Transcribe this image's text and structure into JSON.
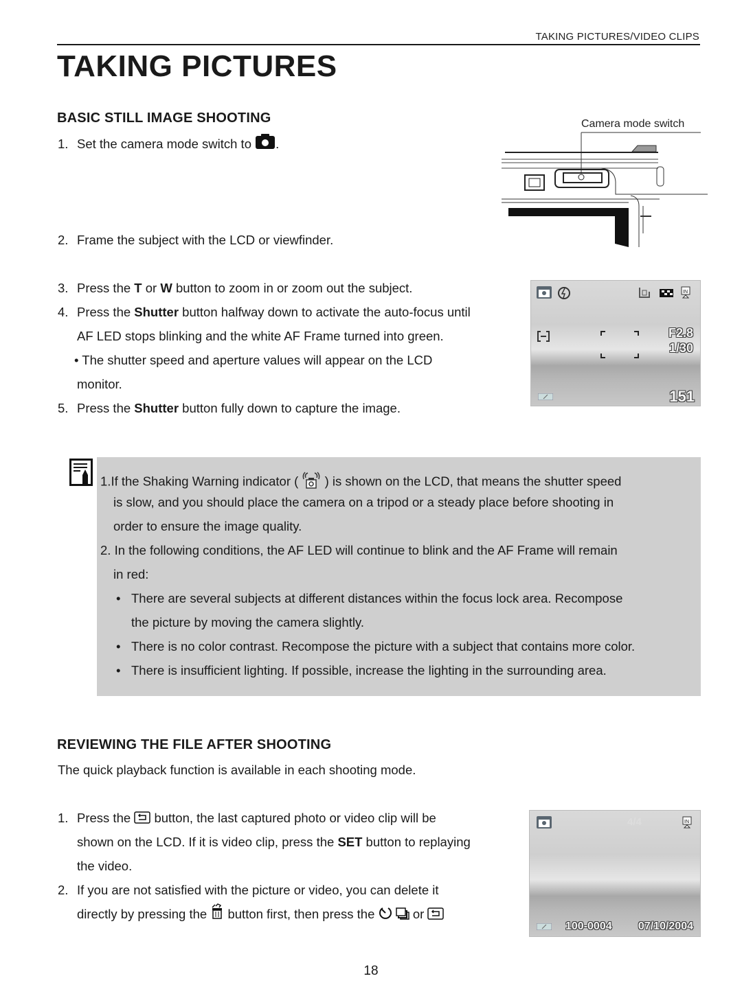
{
  "running_head": "TAKING PICTURES/VIDEO CLIPS",
  "page_title": "TAKING PICTURES",
  "section1": {
    "heading": "BASIC STILL IMAGE SHOOTING",
    "diagram_label": "Camera mode switch",
    "steps": [
      {
        "num": "1.",
        "pre": "Set the camera mode switch to",
        "icon": "camera-icon",
        "post": "."
      },
      {
        "num": "2.",
        "text": "Frame the subject with the LCD or viewfinder."
      },
      {
        "num": "3.",
        "parts": [
          "Press the ",
          "T",
          " or ",
          "W",
          " button to zoom in or zoom out the subject."
        ]
      },
      {
        "num": "4.",
        "parts": [
          "Press the ",
          "Shutter",
          " button halfway down to activate the auto-focus until"
        ],
        "line2": "AF LED stops blinking and the white AF Frame turned into green.",
        "bullet": "• The shutter speed and aperture values will appear on the LCD",
        "bullet_line2": "monitor."
      },
      {
        "num": "5.",
        "parts": [
          "Press the ",
          "Shutter",
          " button fully down to capture the image."
        ]
      }
    ],
    "lcd": {
      "aperture": "F2.8",
      "shutter_speed": "1/30",
      "shots_remaining": "151",
      "icons": [
        "camera-mode-icon",
        "flash-off-icon",
        "image-size-icon",
        "quality-icon",
        "internal-memory-icon",
        "af-bracket-icon",
        "battery-icon"
      ]
    }
  },
  "note": {
    "items": [
      {
        "num": "1.",
        "pre": "If the Shaking Warning indicator (",
        "icon": "shake-warning-icon",
        "post": ") is shown on the LCD, that means the shutter speed",
        "line2": "is slow, and you should place the camera on a tripod or a steady place before shooting in",
        "line3": "order to ensure the image quality."
      },
      {
        "num": "2.",
        "text": "In the following conditions, the AF LED will continue to blink and the AF Frame will remain",
        "line2": "in red:"
      }
    ],
    "bullets": [
      {
        "text": "There are several subjects at different distances within the focus lock area. Recompose",
        "line2": "the picture by moving the camera slightly."
      },
      {
        "text": "There is no color contrast. Recompose the picture with a subject that contains more color."
      },
      {
        "text": "There is insufficient lighting. If possible, increase the lighting in the surrounding area."
      }
    ],
    "bullet_glyph": "•"
  },
  "section2": {
    "heading": "REVIEWING THE FILE AFTER SHOOTING",
    "intro": "The quick playback function is available in each shooting mode.",
    "steps": [
      {
        "num": "1.",
        "pre": "Press the",
        "icon": "playback-icon",
        "post": "button, the last captured photo or video clip will be",
        "line2_parts": [
          "shown on the LCD. If it is video clip, press the ",
          "SET",
          " button to replaying"
        ],
        "line3": "the video."
      },
      {
        "num": "2.",
        "text": "If you are not satisfied with the picture or video, you can delete it",
        "line2_pre": "directly by pressing the",
        "line2_mid": "button first, then press the",
        "line2_or": "or"
      }
    ],
    "lcd": {
      "frame_count": "4/4",
      "file_number": "100-0004",
      "date": "07/10/2004"
    }
  },
  "page_number": "18"
}
